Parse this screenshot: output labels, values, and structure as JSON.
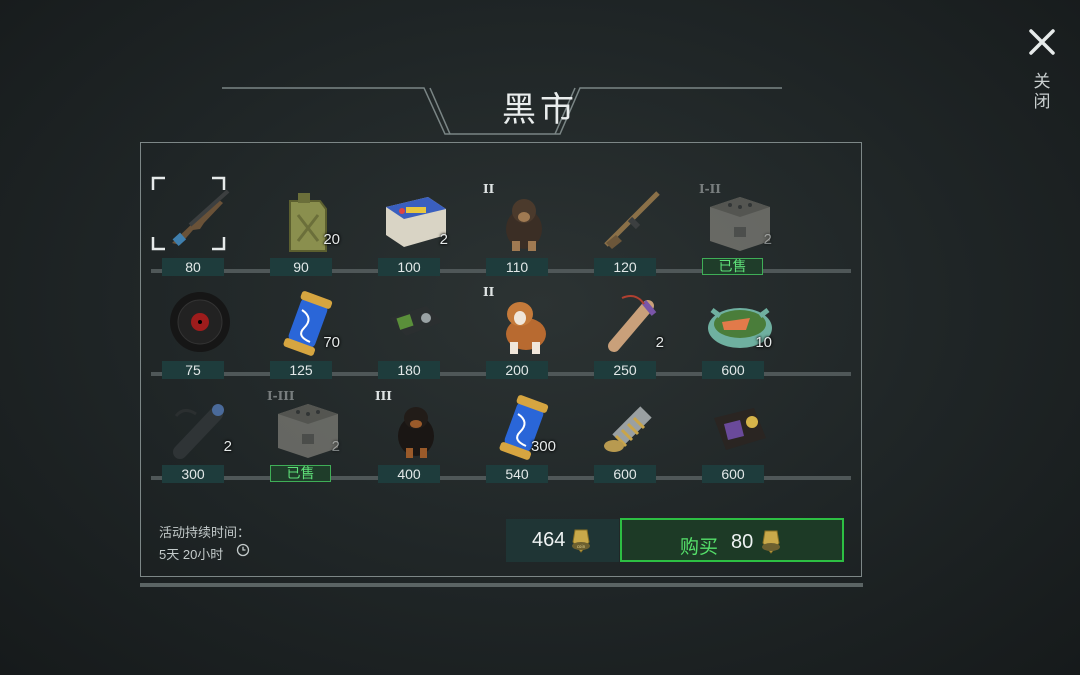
{
  "title": "黑市",
  "close": {
    "label": "关闭"
  },
  "sold_label": "已售",
  "rows": [
    [
      {
        "name": "ak-rifle",
        "price": "80",
        "qty": "",
        "tier": "",
        "sold": false,
        "selected": true
      },
      {
        "name": "jerrycan",
        "price": "90",
        "qty": "20",
        "tier": "",
        "sold": false
      },
      {
        "name": "car-battery",
        "price": "100",
        "qty": "2",
        "tier": "",
        "sold": false
      },
      {
        "name": "shepherd-dog",
        "price": "110",
        "qty": "",
        "tier": "II",
        "sold": false
      },
      {
        "name": "sniper-rifle",
        "price": "120",
        "qty": "",
        "tier": "",
        "sold": false
      },
      {
        "name": "crate",
        "price": "已售",
        "qty": "2",
        "tier": "I-II",
        "sold": true
      }
    ],
    [
      {
        "name": "vinyl-record",
        "price": "75",
        "qty": "",
        "tier": "",
        "sold": false
      },
      {
        "name": "dna-capsule",
        "price": "125",
        "qty": "70",
        "tier": "",
        "sold": false
      },
      {
        "name": "radio-device",
        "price": "180",
        "qty": "",
        "tier": "",
        "sold": false
      },
      {
        "name": "saint-bernard-dog",
        "price": "200",
        "qty": "",
        "tier": "II",
        "sold": false
      },
      {
        "name": "scroll-pipe",
        "price": "250",
        "qty": "2",
        "tier": "",
        "sold": false
      },
      {
        "name": "salmon-bowl",
        "price": "600",
        "qty": "10",
        "tier": "",
        "sold": false
      }
    ],
    [
      {
        "name": "scope-part",
        "price": "300",
        "qty": "2",
        "tier": "",
        "sold": false
      },
      {
        "name": "crate",
        "price": "已售",
        "qty": "2",
        "tier": "I-III",
        "sold": true
      },
      {
        "name": "rottweiler-dog",
        "price": "400",
        "qty": "",
        "tier": "III",
        "sold": false
      },
      {
        "name": "dna-capsule",
        "price": "540",
        "qty": "300",
        "tier": "",
        "sold": false
      },
      {
        "name": "spring-part",
        "price": "600",
        "qty": "",
        "tier": "",
        "sold": false
      },
      {
        "name": "police-badge",
        "price": "600",
        "qty": "",
        "tier": "",
        "sold": false
      }
    ]
  ],
  "duration": {
    "label": "活动持续时间：",
    "value": "5天 20小时"
  },
  "balance": "464",
  "buy": {
    "label": "购买",
    "price": "80"
  },
  "colors": {
    "buy_border": "#2dbf43",
    "buy_text": "#55e06a",
    "price_bg": "#1e3c3c"
  },
  "icons": {
    "coin": "coin-icon",
    "clock": "clock-icon",
    "close": "close-icon"
  }
}
